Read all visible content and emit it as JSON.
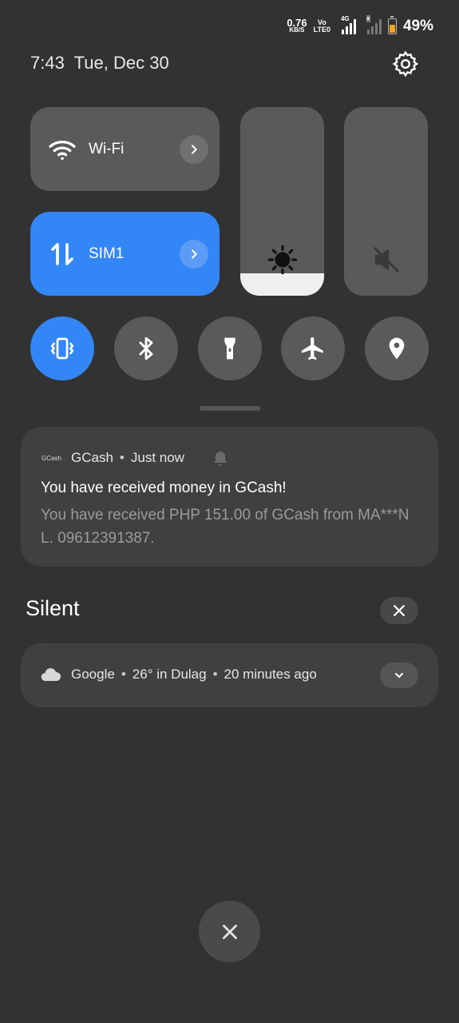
{
  "status_bar": {
    "net_speed_value": "0.76",
    "net_speed_unit": "KB/S",
    "volte_top": "Vo",
    "volte_bottom": "LTE0",
    "network_type": "4G",
    "battery_percent": "49%",
    "battery_level": 0.49,
    "battery_color": "#f4a623"
  },
  "header": {
    "time": "7:43",
    "date": "Tue, Dec 30",
    "settings_icon": "gear-icon"
  },
  "tiles": {
    "wifi": {
      "label": "Wi-Fi",
      "icon": "wifi-icon",
      "active": false
    },
    "sim": {
      "label": "SIM1",
      "icon": "mobile-data-icon",
      "active": true
    }
  },
  "sliders": {
    "brightness_level": 0.12,
    "volume_muted": true
  },
  "quick_buttons": [
    {
      "icon": "vibrate-icon",
      "active": true
    },
    {
      "icon": "bluetooth-icon",
      "active": false
    },
    {
      "icon": "flashlight-icon",
      "active": false
    },
    {
      "icon": "airplane-icon",
      "active": false
    },
    {
      "icon": "location-icon",
      "active": false
    }
  ],
  "accent_color": "#3386f5",
  "notifications": {
    "gcash": {
      "logo_text": "GCash",
      "app": "GCash",
      "time": "Just now",
      "title": "You have received money in GCash!",
      "body": "You have received PHP 151.00 of GCash from MA***N L. 09612391387."
    },
    "silent_section_label": "Silent",
    "google": {
      "app": "Google",
      "summary": "26° in Dulag",
      "time": "20 minutes ago"
    }
  }
}
